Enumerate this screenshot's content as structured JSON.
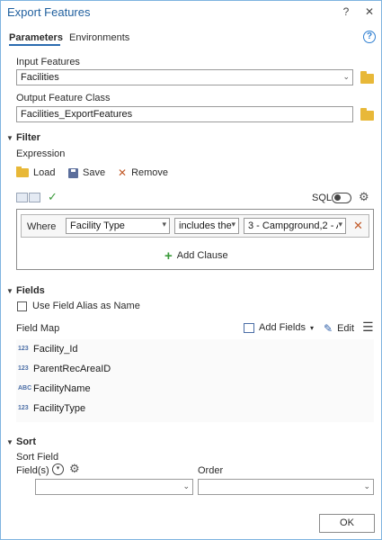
{
  "window": {
    "title": "Export Features",
    "help_glyph": "?",
    "close_glyph": "✕"
  },
  "tabs": [
    {
      "label": "Parameters",
      "active": true
    },
    {
      "label": "Environments",
      "active": false
    }
  ],
  "help_icon_glyph": "?",
  "input_features": {
    "label": "Input Features",
    "value": "Facilities"
  },
  "output_feature_class": {
    "label": "Output Feature Class",
    "value": "Facilities_ExportFeatures"
  },
  "filter": {
    "title": "Filter",
    "expression_label": "Expression",
    "load_label": "Load",
    "save_label": "Save",
    "remove_label": "Remove",
    "sql_label": "SQL",
    "where_label": "Where",
    "field_value": "Facility Type",
    "operator_value": "includes the",
    "values_value": "3 - Campground,2 - A",
    "add_clause_label": "Add Clause"
  },
  "fields": {
    "title": "Fields",
    "use_alias_label": "Use Field Alias as Name",
    "field_map_label": "Field Map",
    "add_fields_label": "Add Fields",
    "edit_label": "Edit",
    "items": [
      {
        "type": "123",
        "name": "Facility_Id"
      },
      {
        "type": "123",
        "name": "ParentRecAreaID"
      },
      {
        "type": "ABC",
        "name": "FacilityName"
      },
      {
        "type": "123",
        "name": "FacilityType"
      }
    ]
  },
  "sort": {
    "title": "Sort",
    "sort_field_label": "Sort Field",
    "fields_label": "Field(s)",
    "order_label": "Order"
  },
  "ok_label": "OK",
  "colors": {
    "title_blue": "#1f5f9e",
    "accent_blue": "#2f7fd1",
    "folder_yellow": "#e8b838",
    "check_green": "#3a9a3a",
    "remove_orange": "#c25b2a"
  }
}
